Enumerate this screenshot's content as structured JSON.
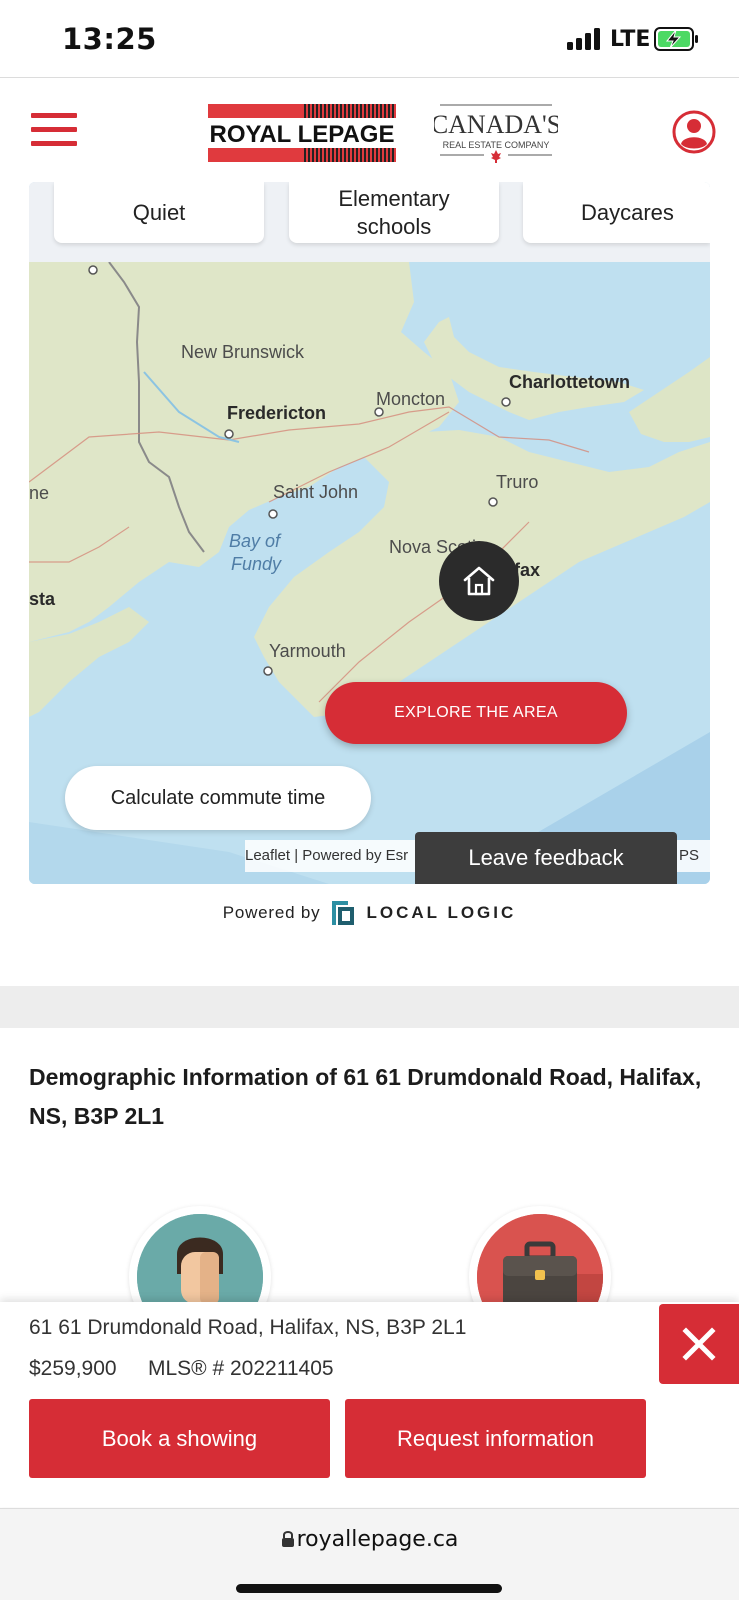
{
  "status_bar": {
    "time": "13:25",
    "network": "LTE",
    "icons": [
      "signal-icon",
      "battery-charging-icon"
    ]
  },
  "header": {
    "brand_name": "ROYAL LEPAGE",
    "tagline_main": "CANADA'S",
    "tagline_sub": "REAL ESTATE COMPANY",
    "icons": [
      "hamburger-menu-icon",
      "user-account-icon",
      "maple-leaf-icon"
    ],
    "brand_color": "#d62d36"
  },
  "map": {
    "tags": [
      "Quiet",
      "Elementary schools",
      "Daycares"
    ],
    "labels": {
      "new_brunswick": "New Brunswick",
      "fredericton": "Fredericton",
      "moncton": "Moncton",
      "charlottetown": "Charlottetown",
      "saint_john": "Saint John",
      "truro": "Truro",
      "bay_of": "Bay of",
      "fundy": "Fundy",
      "nova_scotia": "Nova Scotia",
      "halifax": "lifax",
      "yarmouth": "Yarmouth",
      "left_edge_1": "ne",
      "left_edge_2": "sta"
    },
    "explore_button": "EXPLORE THE AREA",
    "commute_button": "Calculate commute time",
    "attribution": "Leaflet | Powered by Esr",
    "attribution_tail": "PS",
    "feedback_button": "Leave feedback",
    "marker_icon": "home-icon"
  },
  "powered_by": {
    "text": "Powered by",
    "brand": "LOCAL LOGIC"
  },
  "demographics": {
    "title": "Demographic Information of 61 61 Drumdonald Road, Halifax, NS, B3P 2L1",
    "icons": [
      "person-avatar-icon",
      "briefcase-icon"
    ]
  },
  "listing_bar": {
    "address": "61 61 Drumdonald Road, Halifax, NS, B3P 2L1",
    "price": "$259,900",
    "mls": "MLS® # 202211405",
    "book_button": "Book a showing",
    "request_button": "Request information",
    "close_icon": "close-icon"
  },
  "browser": {
    "url": "royallepage.ca",
    "lock_icon": "lock-icon"
  }
}
